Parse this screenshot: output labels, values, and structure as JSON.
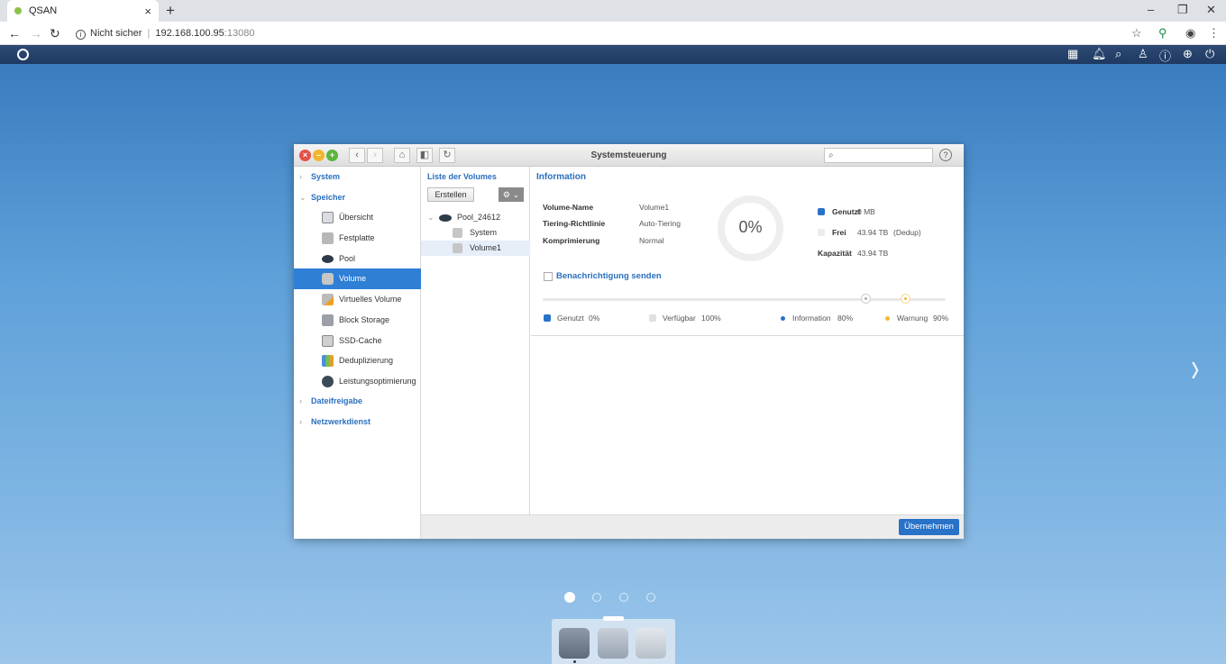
{
  "browser": {
    "tab_title": "QSAN",
    "tab_close": "×",
    "new_tab": "+",
    "security_label": "Nicht sicher",
    "url_host": "192.168.100.95",
    "url_port": ":13080"
  },
  "window": {
    "title": "Systemsteuerung",
    "search_placeholder": "",
    "help": "?"
  },
  "sidebar": {
    "groups": [
      {
        "label": "System"
      },
      {
        "label": "Speicher"
      },
      {
        "label": "Dateifreigabe"
      },
      {
        "label": "Netzwerkdienst"
      }
    ],
    "items": [
      {
        "label": "Übersicht"
      },
      {
        "label": "Festplatte"
      },
      {
        "label": "Pool"
      },
      {
        "label": "Volume"
      },
      {
        "label": "Virtuelles Volume"
      },
      {
        "label": "Block Storage"
      },
      {
        "label": "SSD-Cache"
      },
      {
        "label": "Deduplizierung"
      },
      {
        "label": "Leistungsoptimierung"
      }
    ]
  },
  "volumes": {
    "title": "Liste der Volumes",
    "create_label": "Erstellen",
    "tree": [
      {
        "label": "Pool_24612"
      },
      {
        "label": "System"
      },
      {
        "label": "Volume1"
      }
    ]
  },
  "details": {
    "title": "Information",
    "fields": [
      {
        "key": "Volume-Name",
        "value": "Volume1"
      },
      {
        "key": "Tiering-Richtlinie",
        "value": "Auto-Tiering"
      },
      {
        "key": "Komprimierung",
        "value": "Normal"
      }
    ],
    "usage_percent_label": "0%",
    "used_fraction": 0,
    "legend": {
      "used_label": "Genutzt",
      "used_value": "0 MB",
      "free_label": "Frei",
      "free_value": "43.94 TB",
      "free_note": "(Dedup)",
      "capacity_label": "Kapazität",
      "capacity_value": "43.94 TB"
    },
    "notify_label": "Benachrichtigung senden",
    "thresholds": {
      "information_fraction": 0.8,
      "warning_fraction": 0.9
    },
    "bottom_legend": {
      "used": "Genutzt",
      "used_pct": "0%",
      "available": "Verfügbar",
      "available_pct": "100%",
      "information": "Information",
      "information_pct": "80%",
      "warning": "Warnung",
      "warning_pct": "90%"
    },
    "colors": {
      "used": "#2872c8",
      "free": "#e0e0e0",
      "information": "#2872c8",
      "warning": "#f5b730"
    }
  },
  "footer": {
    "apply_label": "Übernehmen"
  },
  "pager": {
    "pages": 4,
    "active": 1
  }
}
